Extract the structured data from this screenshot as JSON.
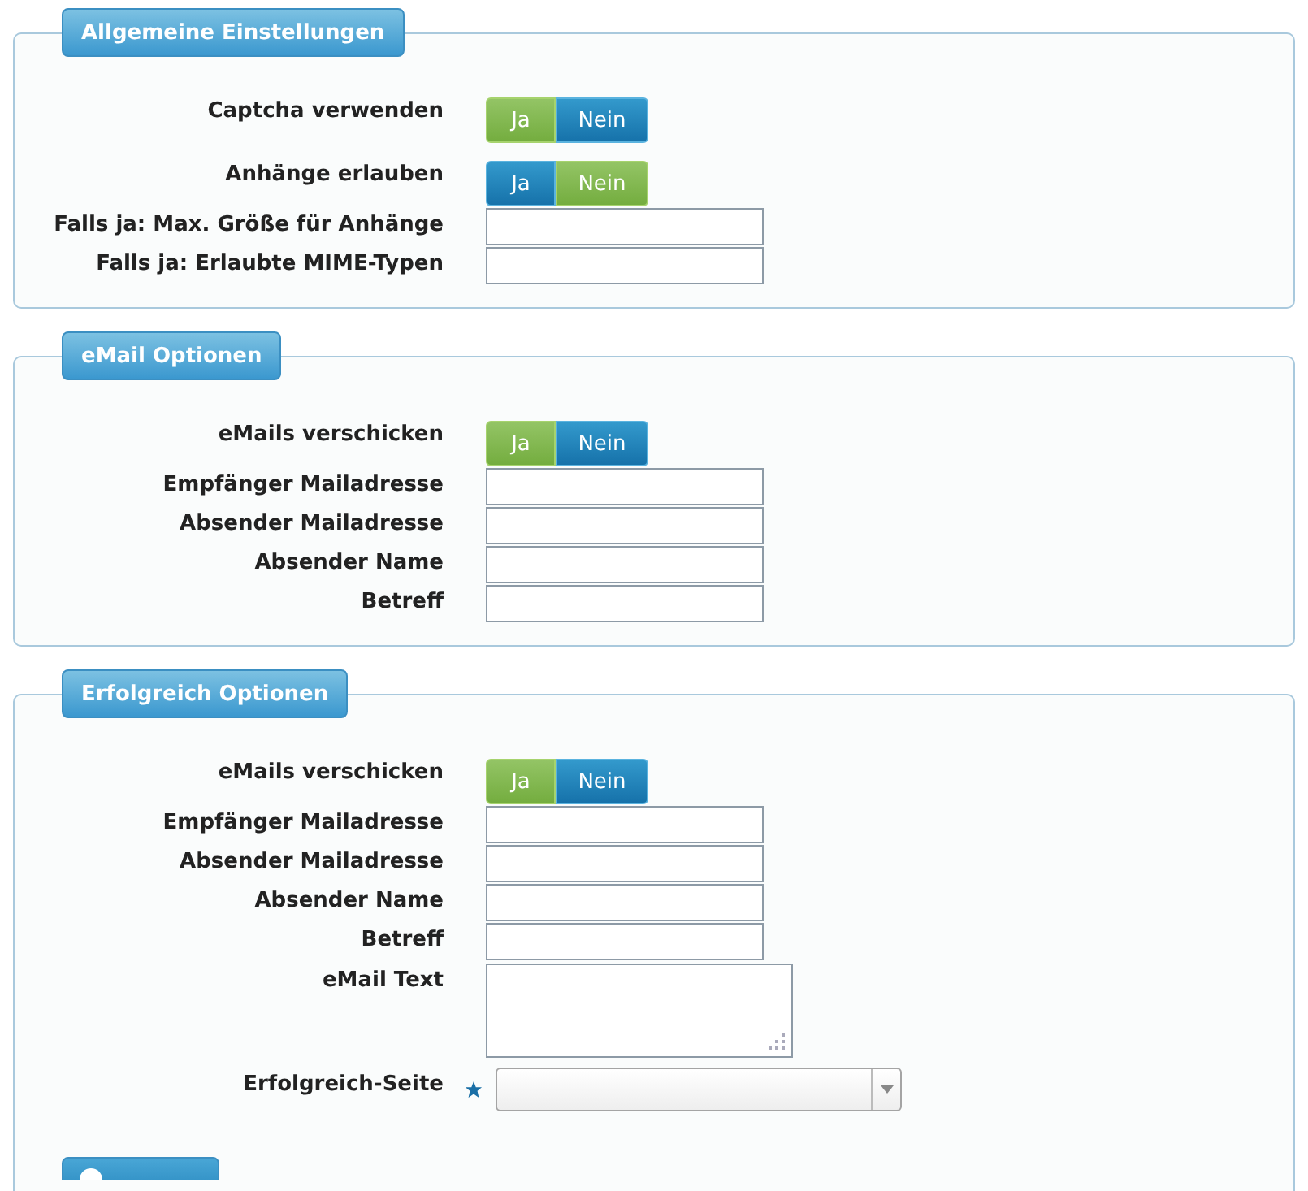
{
  "sections": [
    {
      "title": "Allgemeine Einstellungen",
      "fields": [
        {
          "kind": "toggle",
          "label": "Captcha verwenden",
          "options": [
            {
              "label": "Ja",
              "selected": true
            },
            {
              "label": "Nein",
              "selected": false
            }
          ]
        },
        {
          "kind": "toggle",
          "label": "Anhänge erlauben",
          "options": [
            {
              "label": "Ja",
              "selected": false
            },
            {
              "label": "Nein",
              "selected": true
            }
          ]
        },
        {
          "kind": "text",
          "label": "Falls ja: Max. Größe für Anhänge"
        },
        {
          "kind": "text",
          "label": "Falls ja: Erlaubte MIME-Typen"
        }
      ]
    },
    {
      "title": "eMail Optionen",
      "fields": [
        {
          "kind": "toggle",
          "label": "eMails verschicken",
          "options": [
            {
              "label": "Ja",
              "selected": true
            },
            {
              "label": "Nein",
              "selected": false
            }
          ]
        },
        {
          "kind": "text",
          "label": "Empfänger Mailadresse"
        },
        {
          "kind": "text",
          "label": "Absender Mailadresse"
        },
        {
          "kind": "text",
          "label": "Absender Name"
        },
        {
          "kind": "text",
          "label": "Betreff"
        }
      ]
    },
    {
      "title": "Erfolgreich Optionen",
      "fields": [
        {
          "kind": "toggle",
          "label": "eMails verschicken",
          "options": [
            {
              "label": "Ja",
              "selected": true
            },
            {
              "label": "Nein",
              "selected": false
            }
          ]
        },
        {
          "kind": "text",
          "label": "Empfänger Mailadresse"
        },
        {
          "kind": "text",
          "label": "Absender Mailadresse"
        },
        {
          "kind": "text",
          "label": "Absender Name"
        },
        {
          "kind": "text",
          "label": "Betreff"
        },
        {
          "kind": "textarea",
          "label": "eMail Text"
        },
        {
          "kind": "select",
          "label": "Erfolgreich-Seite",
          "required": true
        }
      ]
    }
  ]
}
